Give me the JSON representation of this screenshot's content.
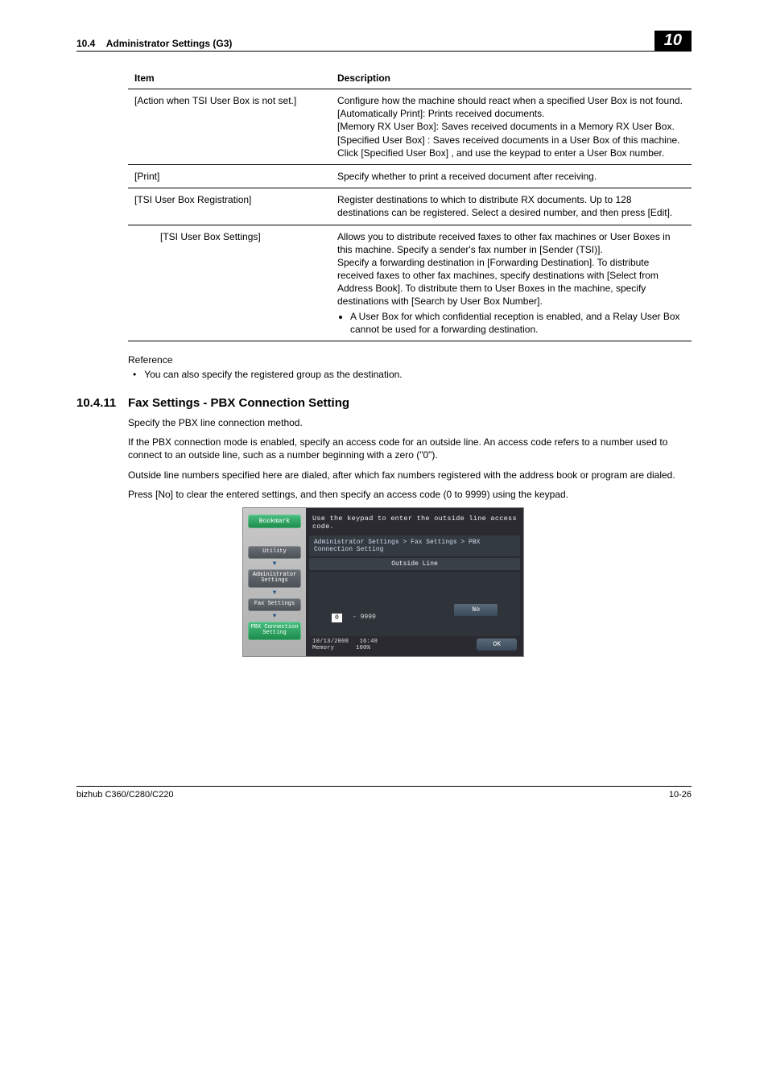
{
  "header": {
    "section_no": "10.4",
    "section_title": "Administrator Settings (G3)",
    "chapter": "10"
  },
  "table": {
    "head_item": "Item",
    "head_desc": "Description",
    "rows": [
      {
        "item": "[Action when TSI User Box is not set.]",
        "desc": "Configure how the machine should react when a specified User Box is not found.\n[Automatically Print]: Prints received documents.\n[Memory RX User Box]: Saves received documents in a Memory RX User Box.\n[Specified User Box] : Saves received documents in a User Box of this machine. Click [Specified User Box] , and use the keypad to enter a User Box number."
      },
      {
        "item": "[Print]",
        "desc": "Specify whether to print a received document after receiving."
      },
      {
        "item": "[TSI User Box Registration]",
        "desc": "Register destinations to which to distribute RX documents. Up to 128 destinations can be registered. Select a desired number, and then press [Edit]."
      },
      {
        "item_sub": "[TSI User Box Settings]",
        "desc": "Allows you to distribute received faxes to other fax machines or User Boxes in this machine. Specify a sender's fax number in [Sender (TSI)].\nSpecify a forwarding destination in [Forwarding Destination]. To distribute received faxes to other fax machines, specify destinations with [Select from Address Book]. To distribute them to User Boxes in the machine, specify destinations with [Search by User Box Number].",
        "bullet": "A User Box for which confidential reception is enabled, and a Relay User Box cannot be used for a forwarding destination."
      }
    ]
  },
  "reference": {
    "label": "Reference",
    "bullet": "You can also specify the registered group as the destination."
  },
  "section": {
    "num": "10.4.11",
    "title": "Fax Settings - PBX Connection Setting",
    "p1": "Specify the PBX line connection method.",
    "p2": "If the PBX connection mode is enabled, specify an access code for an outside line. An access code refers to a number used to connect to an outside line, such as a number beginning with a zero (\"0\").",
    "p3": "Outside line numbers specified here are dialed, after which fax numbers registered with the address book or program are dialed.",
    "p4": "Press [No] to clear the entered settings, and then specify an access code (0 to 9999) using the keypad."
  },
  "panel": {
    "top_msg": "Use the keypad to enter the outside line access code.",
    "breadcrumb": "Administrator Settings > Fax Settings > PBX Connection Setting",
    "subhead": "Outside Line",
    "bookmark": "Bookmark",
    "utility": "Utility",
    "admin": "Administrator Settings",
    "fax": "Fax Settings",
    "pbx": "PBX Connection Setting",
    "no_btn": "No",
    "range_val": "0",
    "range_txt": "-  9999",
    "date": "10/13/2008",
    "time": "16:48",
    "mem_lbl": "Memory",
    "mem_val": "100%",
    "ok": "OK"
  },
  "footer": {
    "model": "bizhub C360/C280/C220",
    "page": "10-26"
  }
}
